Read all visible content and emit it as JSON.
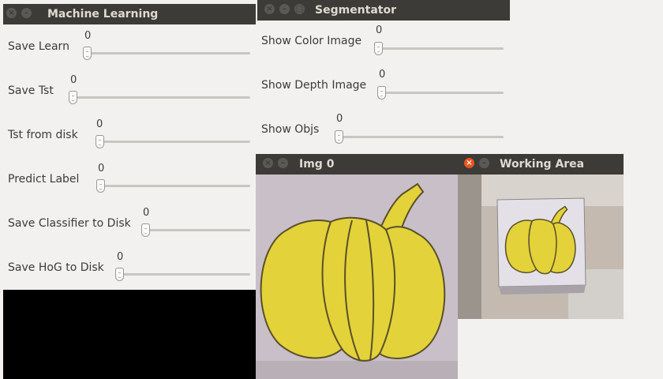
{
  "segmentator": {
    "title": "Segmentator",
    "trackbars": [
      {
        "label": "Show Color Image",
        "value": "0"
      },
      {
        "label": "Show Depth Image",
        "value": "0"
      },
      {
        "label": "Show Objs",
        "value": "0"
      }
    ]
  },
  "machine_learning": {
    "title": "Machine Learning",
    "trackbars": [
      {
        "label": "Save Learn",
        "value": "0"
      },
      {
        "label": "Save Tst",
        "value": "0"
      },
      {
        "label": "Tst from disk",
        "value": "0"
      },
      {
        "label": "Predict Label",
        "value": "0"
      },
      {
        "label": "Save Classifier to Disk",
        "value": "0"
      },
      {
        "label": "Save HoG to Disk",
        "value": "0"
      }
    ]
  },
  "img0": {
    "title": "Img 0"
  },
  "working_area": {
    "title": "Working Area"
  },
  "icons": {
    "close": "close-icon",
    "minimize": "minimize-icon",
    "maximize": "maximize-icon"
  },
  "colors": {
    "titlebar": "#3c3b37",
    "close_active": "#e95420",
    "pumpkin": "#e3d23a",
    "pumpkin_outline": "#5a5028",
    "paper": "#c9bfc8"
  }
}
